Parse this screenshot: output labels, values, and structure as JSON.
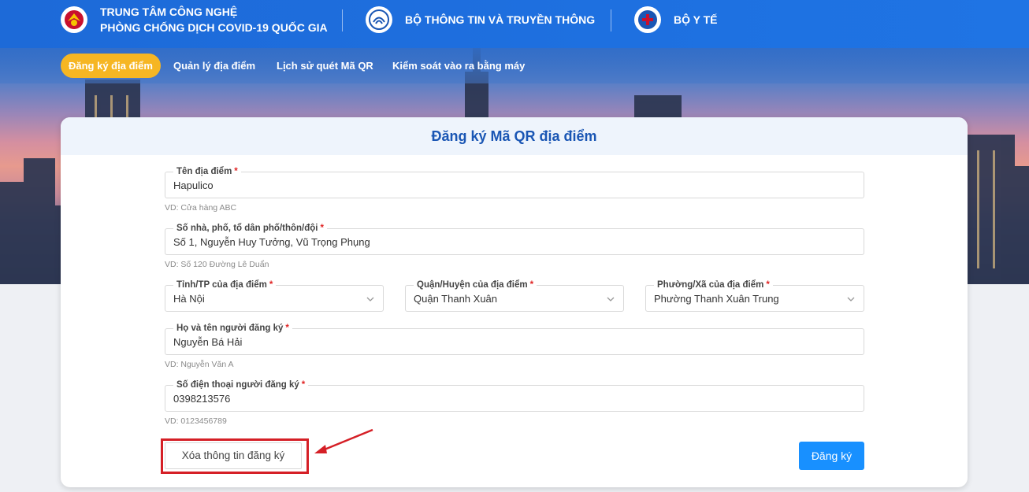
{
  "header": {
    "org1_line1": "TRUNG TÂM CÔNG NGHỆ",
    "org1_line2": "PHÒNG CHỐNG DỊCH COVID-19 QUỐC GIA",
    "org2": "BỘ THÔNG TIN VÀ TRUYỀN THÔNG",
    "org3": "BỘ Y TẾ"
  },
  "nav": {
    "items": [
      {
        "label": "Đăng ký địa điểm",
        "active": true
      },
      {
        "label": "Quản lý địa điểm"
      },
      {
        "label": "Lịch sử quét Mã QR"
      },
      {
        "label": "Kiểm soát vào ra bằng máy"
      }
    ]
  },
  "form": {
    "title": "Đăng ký Mã QR địa điểm",
    "location_name": {
      "label": "Tên địa điểm",
      "value": "Hapulico",
      "hint": "VD: Cửa hàng ABC"
    },
    "address": {
      "label": "Số nhà, phố, tổ dân phố/thôn/đội",
      "value": "Số 1, Nguyễn Huy Tưởng, Vũ Trọng Phụng",
      "hint": "VD: Số 120 Đường Lê Duẩn"
    },
    "province": {
      "label": "Tỉnh/TP của địa điểm",
      "value": "Hà Nội"
    },
    "district": {
      "label": "Quận/Huyện của địa điểm",
      "value": "Quận Thanh Xuân"
    },
    "ward": {
      "label": "Phường/Xã của địa điểm",
      "value": "Phường Thanh Xuân Trung"
    },
    "registrant_name": {
      "label": "Họ và tên người đăng ký",
      "value": "Nguyễn Bá Hải",
      "hint": "VD: Nguyễn Văn A"
    },
    "phone": {
      "label": "Số điện thoại người đăng ký",
      "value": "0398213576",
      "hint": "VD: 0123456789"
    },
    "required_mark": "*",
    "clear_label": "Xóa thông tin đăng ký",
    "submit_label": "Đăng ký"
  },
  "colors": {
    "primary": "#1890ff",
    "header_blue": "#1e70e0",
    "nav_active": "#f6b623",
    "highlight_red": "#d51f26",
    "title_blue": "#1a56b4"
  }
}
